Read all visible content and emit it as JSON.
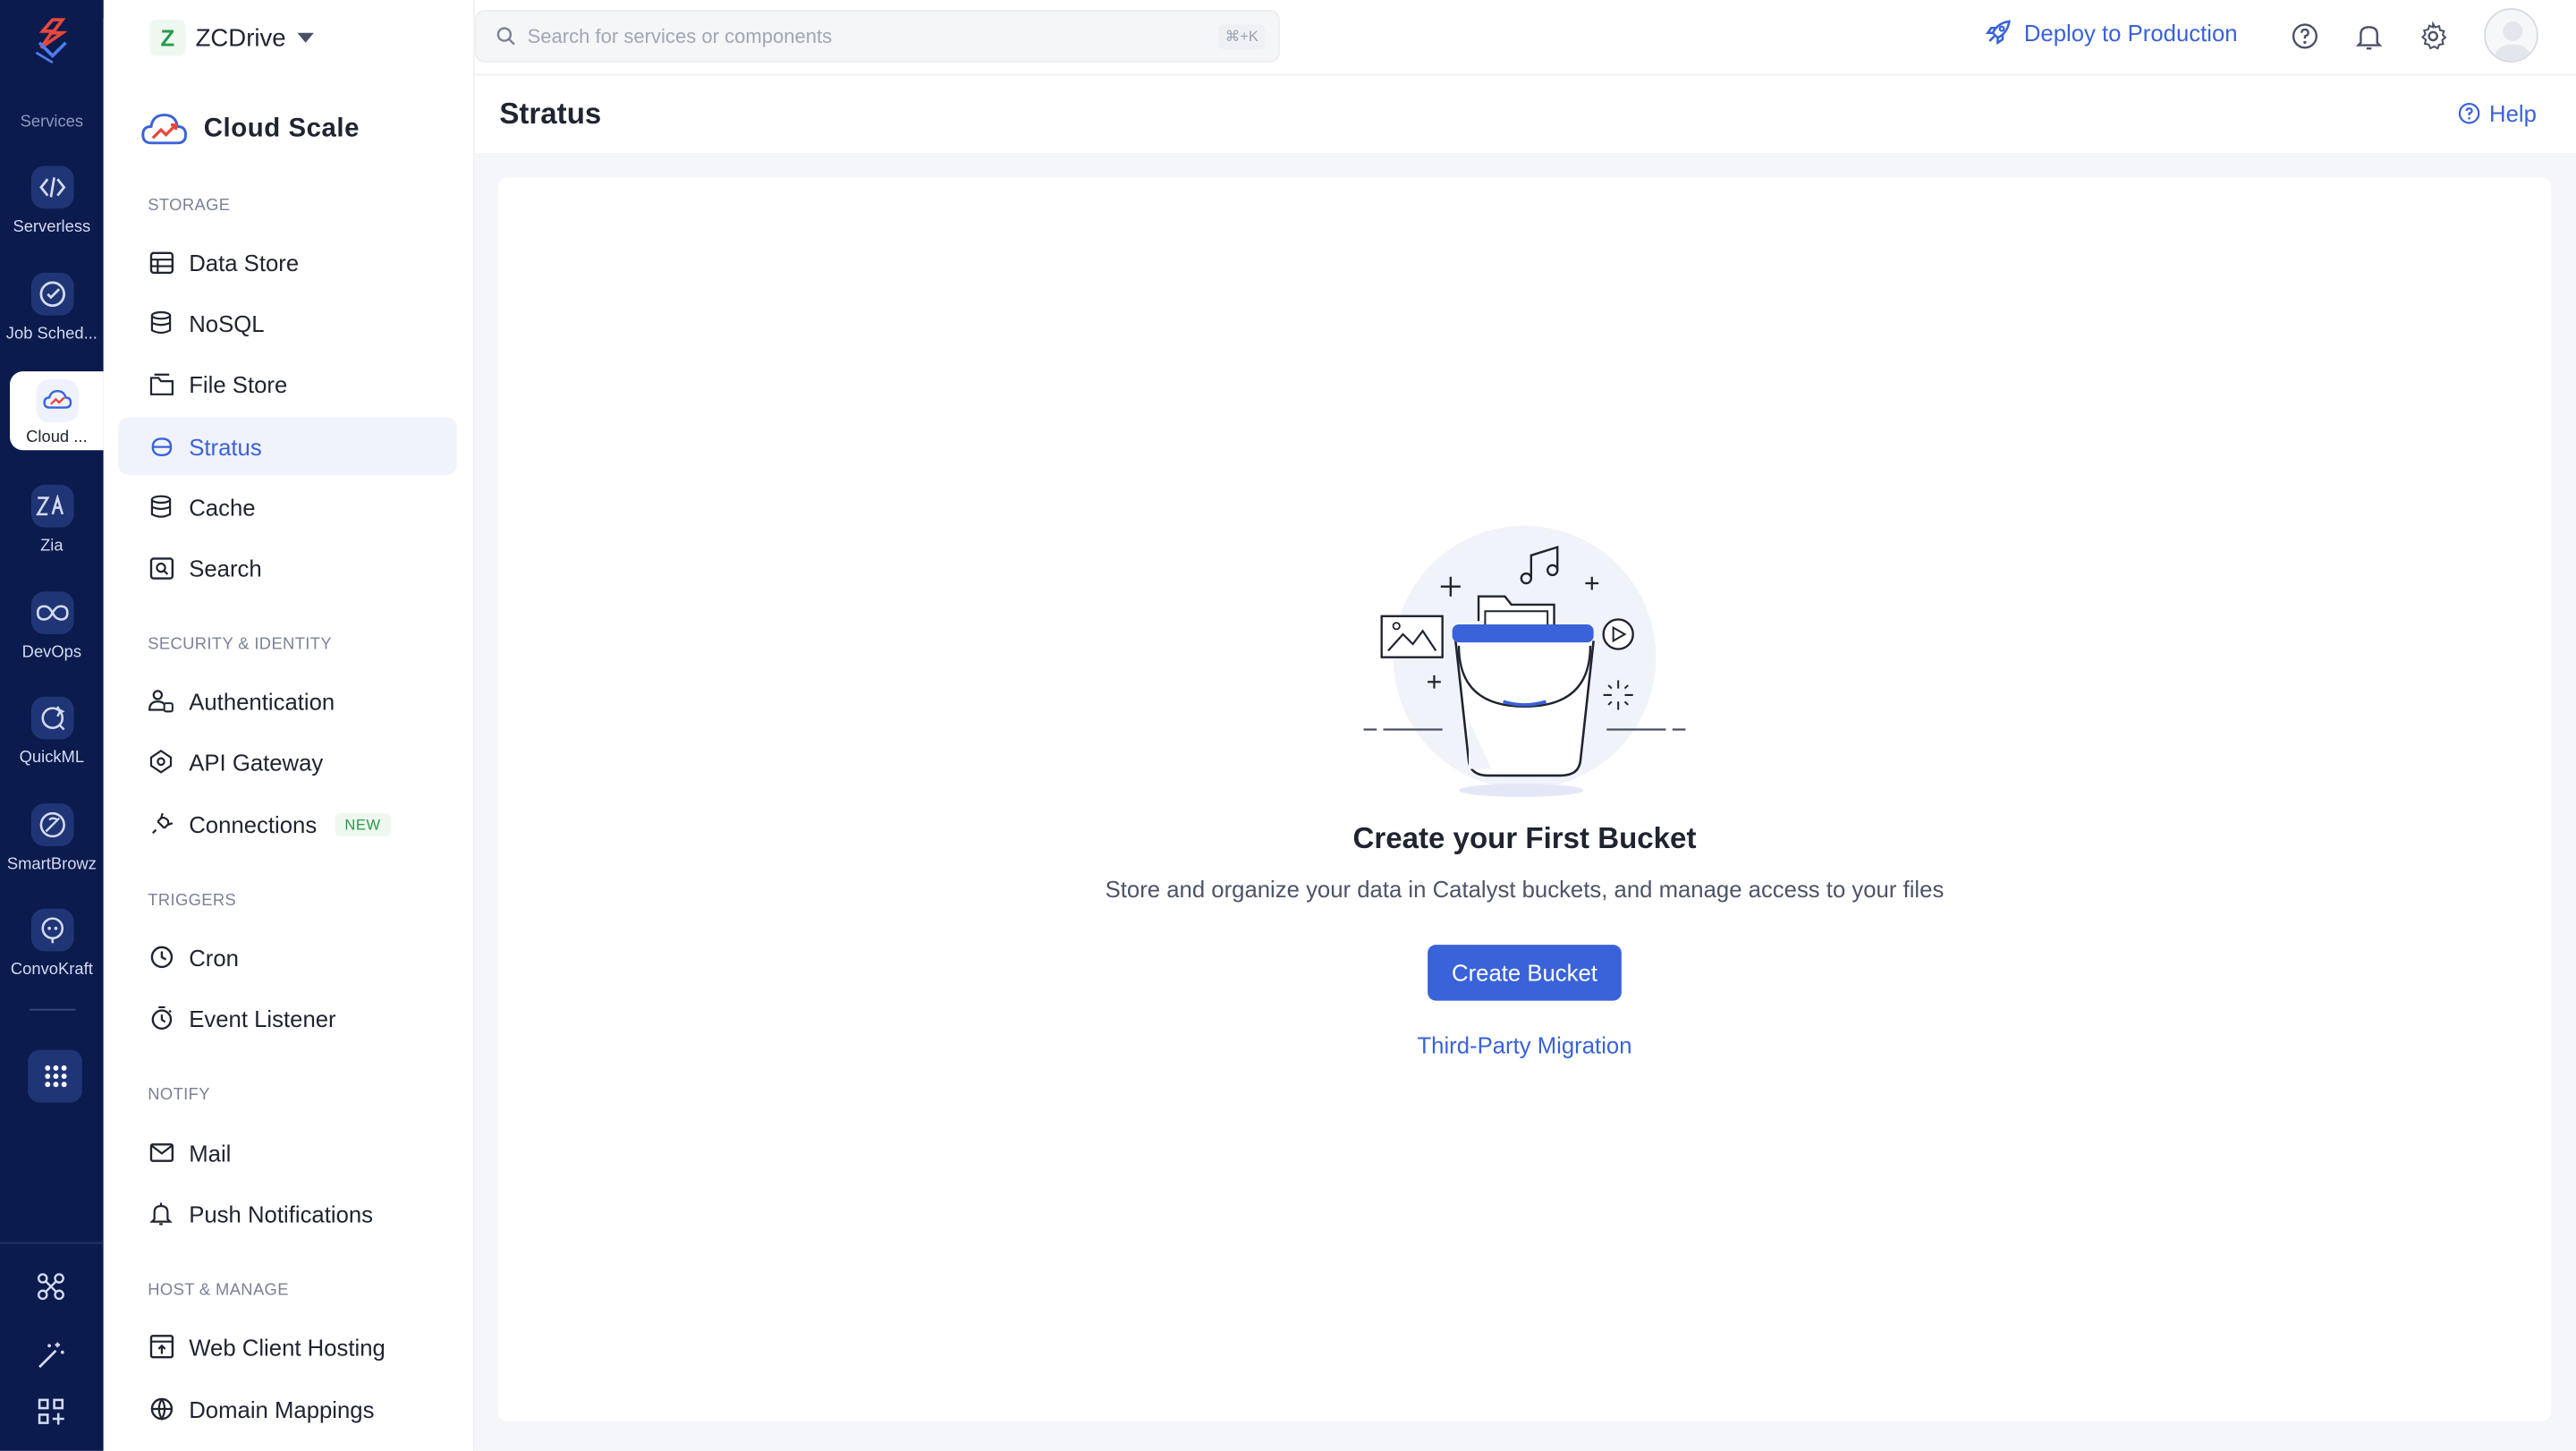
{
  "rail": {
    "services_label": "Services",
    "items": [
      {
        "label": "Serverless",
        "icon": "serverless-icon"
      },
      {
        "label": "Job Sched...",
        "icon": "job-scheduling-icon"
      },
      {
        "label": "Cloud ...",
        "icon": "cloud-scale-icon"
      },
      {
        "label": "Zia",
        "icon": "zia-icon"
      },
      {
        "label": "DevOps",
        "icon": "devops-icon"
      },
      {
        "label": "QuickML",
        "icon": "quickml-icon"
      },
      {
        "label": "SmartBrowz",
        "icon": "smartbrowz-icon"
      },
      {
        "label": "ConvoKraft",
        "icon": "convokraft-icon"
      }
    ]
  },
  "project": {
    "badge": "Z",
    "name": "ZCDrive"
  },
  "sidebar": {
    "title": "Cloud Scale",
    "sections": {
      "storage": "STORAGE",
      "security": "SECURITY & IDENTITY",
      "triggers": "TRIGGERS",
      "notify": "NOTIFY",
      "host": "HOST & MANAGE"
    },
    "items": {
      "data_store": "Data Store",
      "nosql": "NoSQL",
      "file_store": "File Store",
      "stratus": "Stratus",
      "cache": "Cache",
      "search": "Search",
      "authentication": "Authentication",
      "api_gateway": "API Gateway",
      "connections": "Connections",
      "connections_badge": "NEW",
      "cron": "Cron",
      "event_listener": "Event Listener",
      "mail": "Mail",
      "push_notifications": "Push Notifications",
      "web_client_hosting": "Web Client Hosting",
      "domain_mappings": "Domain Mappings"
    }
  },
  "topbar": {
    "search_placeholder": "Search for services or components",
    "search_shortcut": "⌘+K",
    "deploy_label": "Deploy to Production"
  },
  "page": {
    "title": "Stratus",
    "help_label": "Help"
  },
  "empty_state": {
    "title": "Create your First Bucket",
    "subtitle": "Store and organize your data in Catalyst buckets, and manage access to your files",
    "primary_button": "Create Bucket",
    "secondary_link": "Third-Party Migration"
  },
  "colors": {
    "rail_bg": "#0b1b4d",
    "accent": "#3a62d9",
    "new_badge": "#2a9a4b"
  }
}
